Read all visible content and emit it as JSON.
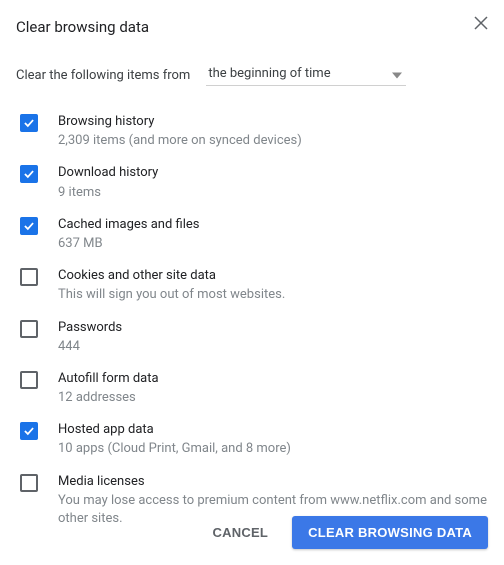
{
  "dialog": {
    "title": "Clear browsing data",
    "range_prefix": "Clear the following items from",
    "range_value": "the beginning of time",
    "options": [
      {
        "label": "Browsing history",
        "sub": "2,309 items (and more on synced devices)",
        "checked": true
      },
      {
        "label": "Download history",
        "sub": "9 items",
        "checked": true
      },
      {
        "label": "Cached images and files",
        "sub": "637 MB",
        "checked": true
      },
      {
        "label": "Cookies and other site data",
        "sub": "This will sign you out of most websites.",
        "checked": false
      },
      {
        "label": "Passwords",
        "sub": "444",
        "checked": false
      },
      {
        "label": "Autofill form data",
        "sub": "12 addresses",
        "checked": false
      },
      {
        "label": "Hosted app data",
        "sub": "10 apps (Cloud Print, Gmail, and 8 more)",
        "checked": true
      },
      {
        "label": "Media licenses",
        "sub": "You may lose access to premium content from www.netflix.com and some other sites.",
        "checked": false
      }
    ],
    "cancel_label": "Cancel",
    "confirm_label": "Clear Browsing Data"
  }
}
